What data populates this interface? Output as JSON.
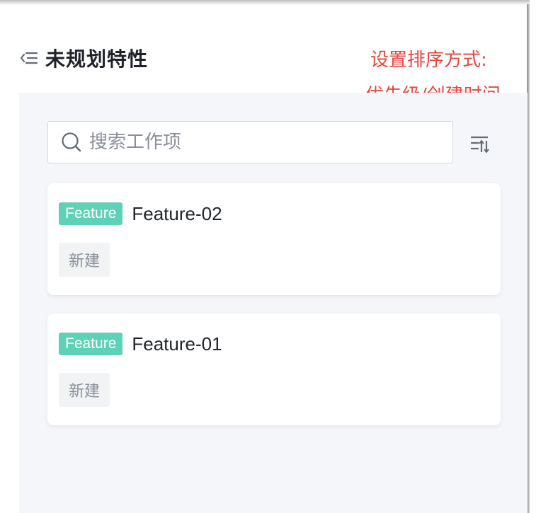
{
  "header": {
    "title": "未规划特性",
    "collapse_icon": "list-collapse-icon"
  },
  "annotation": {
    "line1": "设置排序方式:",
    "line2": "优先级/创建时间",
    "color": "#e8473f"
  },
  "search": {
    "placeholder": "搜索工作项",
    "value": "",
    "icon": "search-icon"
  },
  "sort": {
    "icon": "sort-icon"
  },
  "cards": [
    {
      "type": "Feature",
      "title": "Feature-02",
      "status": "新建"
    },
    {
      "type": "Feature",
      "title": "Feature-01",
      "status": "新建"
    }
  ],
  "colors": {
    "badge": "#5ed1b7",
    "panel_bg": "#f5f6f9",
    "title_text": "#1f2329",
    "status_bg": "#f2f3f5"
  }
}
